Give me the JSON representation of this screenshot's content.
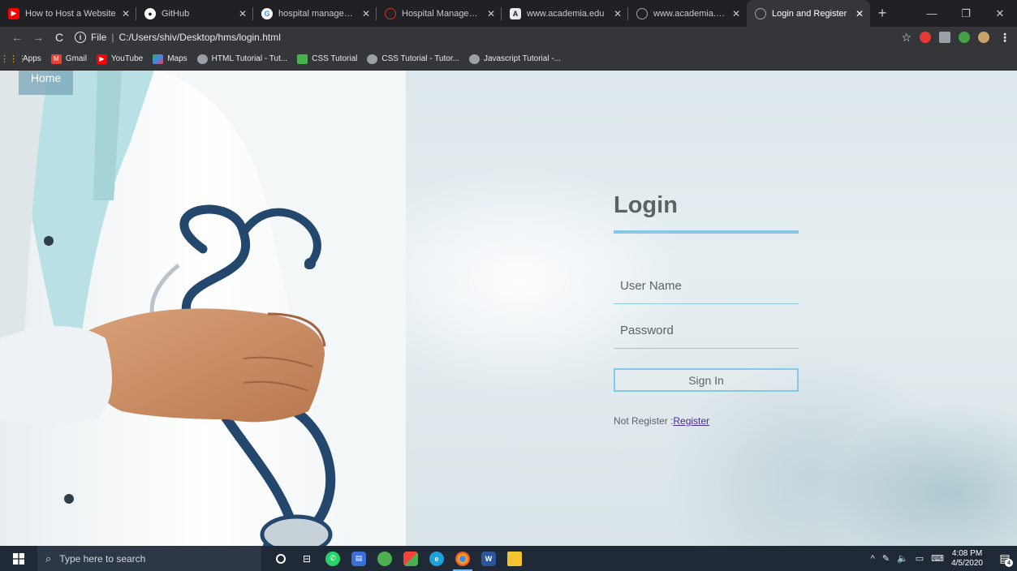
{
  "browser": {
    "tabs": [
      {
        "title": "How to Host a Website",
        "favicon": "youtube-icon",
        "color": "#ff0000",
        "active": false
      },
      {
        "title": "GitHub",
        "favicon": "github-icon",
        "color": "#ffffff",
        "active": false
      },
      {
        "title": "hospital management",
        "favicon": "google-icon",
        "color": "#4285f4",
        "active": false
      },
      {
        "title": "Hospital Management",
        "favicon": "globe-icon",
        "color": "#d93025",
        "active": false
      },
      {
        "title": "www.academia.edu",
        "favicon": "academia-icon",
        "color": "#e8eaed",
        "active": false
      },
      {
        "title": "www.academia.edu",
        "favicon": "globe-icon",
        "color": "#9aa0a6",
        "active": false
      },
      {
        "title": "Login and Register",
        "favicon": "globe-icon",
        "color": "#9aa0a6",
        "active": true
      }
    ],
    "address": {
      "scheme_label": "File",
      "url": "C:/Users/shiv/Desktop/hms/login.html"
    },
    "bookmarks": [
      {
        "label": "Apps",
        "icon": "apps-grid-icon",
        "color": "#f4b400"
      },
      {
        "label": "Gmail",
        "icon": "gmail-icon",
        "color": "#ea4335"
      },
      {
        "label": "YouTube",
        "icon": "youtube-icon",
        "color": "#ff0000"
      },
      {
        "label": "Maps",
        "icon": "maps-icon",
        "color": "#34a853"
      },
      {
        "label": "HTML Tutorial - Tut...",
        "icon": "w3schools-icon",
        "color": "#9aa0a6"
      },
      {
        "label": "CSS Tutorial",
        "icon": "css-tutorial-icon",
        "color": "#4caf50"
      },
      {
        "label": "CSS Tutorial - Tutor...",
        "icon": "w3schools-icon",
        "color": "#9aa0a6"
      },
      {
        "label": "Javascript Tutorial -...",
        "icon": "w3schools-icon",
        "color": "#9aa0a6"
      }
    ]
  },
  "page": {
    "home_label": "Home",
    "login_title": "Login",
    "username_placeholder": "User Name",
    "password_placeholder": "Password",
    "signin_label": "Sign In",
    "register_prompt": "Not Register :",
    "register_link": "Register",
    "accent_color": "#86c9e6"
  },
  "taskbar": {
    "search_placeholder": "Type here to search",
    "time": "4:08 PM",
    "date": "4/5/2020",
    "notification_count": "4"
  }
}
